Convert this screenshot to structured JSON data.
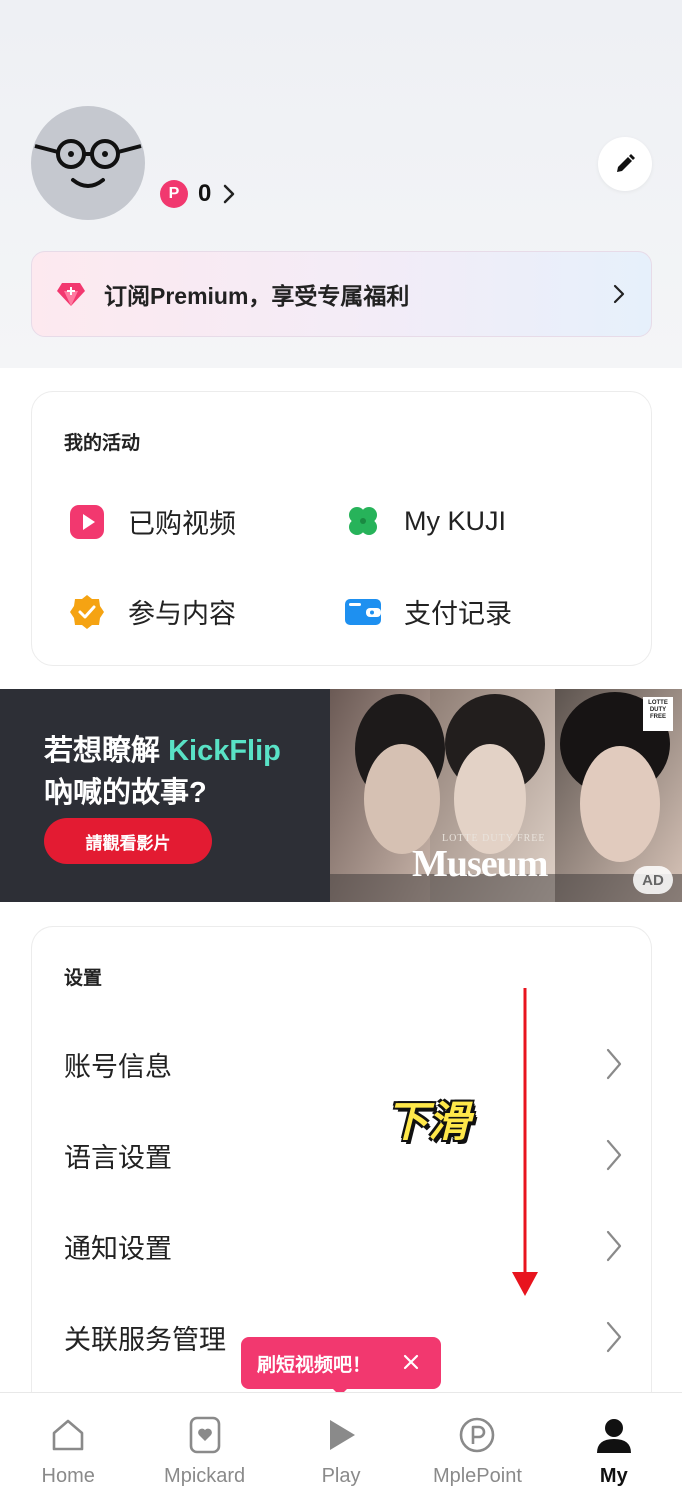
{
  "profile": {
    "points_badge": "P",
    "points_value": "0"
  },
  "premium": {
    "label": "订阅Premium，享受专属福利"
  },
  "activity": {
    "title": "我的活动",
    "items": [
      {
        "label": "已购视频",
        "icon": "play-video-icon"
      },
      {
        "label": "My KUJI",
        "icon": "clover-icon"
      },
      {
        "label": "参与内容",
        "icon": "badge-check-icon"
      },
      {
        "label": "支付记录",
        "icon": "wallet-icon"
      }
    ]
  },
  "ad": {
    "line1_prefix": "若想瞭解 ",
    "line1_highlight": "KickFlip",
    "line2": "吶喊的故事?",
    "cta": "請觀看影片",
    "brand_small": "LOTTE DUTY FREE",
    "brand_big": "Museum",
    "logo": "LOTTE DUTY FREE",
    "badge": "AD"
  },
  "settings": {
    "title": "设置",
    "items": [
      {
        "label": "账号信息"
      },
      {
        "label": "语言设置"
      },
      {
        "label": "通知设置"
      },
      {
        "label": "关联服务管理"
      }
    ]
  },
  "overlay": {
    "swipe_label": "下滑"
  },
  "tooltip": {
    "text": "刷短视频吧！"
  },
  "nav": {
    "items": [
      {
        "label": "Home",
        "icon": "home-icon"
      },
      {
        "label": "Mpickard",
        "icon": "card-heart-icon"
      },
      {
        "label": "Play",
        "icon": "play-icon"
      },
      {
        "label": "MplePoint",
        "icon": "point-icon"
      },
      {
        "label": "My",
        "icon": "person-icon",
        "active": true
      }
    ]
  },
  "colors": {
    "accent": "#f2386f",
    "ad_highlight": "#59e2c6",
    "ad_cta": "#e31b32",
    "arrow": "#e8141e",
    "swipe_text": "#ffe84a"
  }
}
